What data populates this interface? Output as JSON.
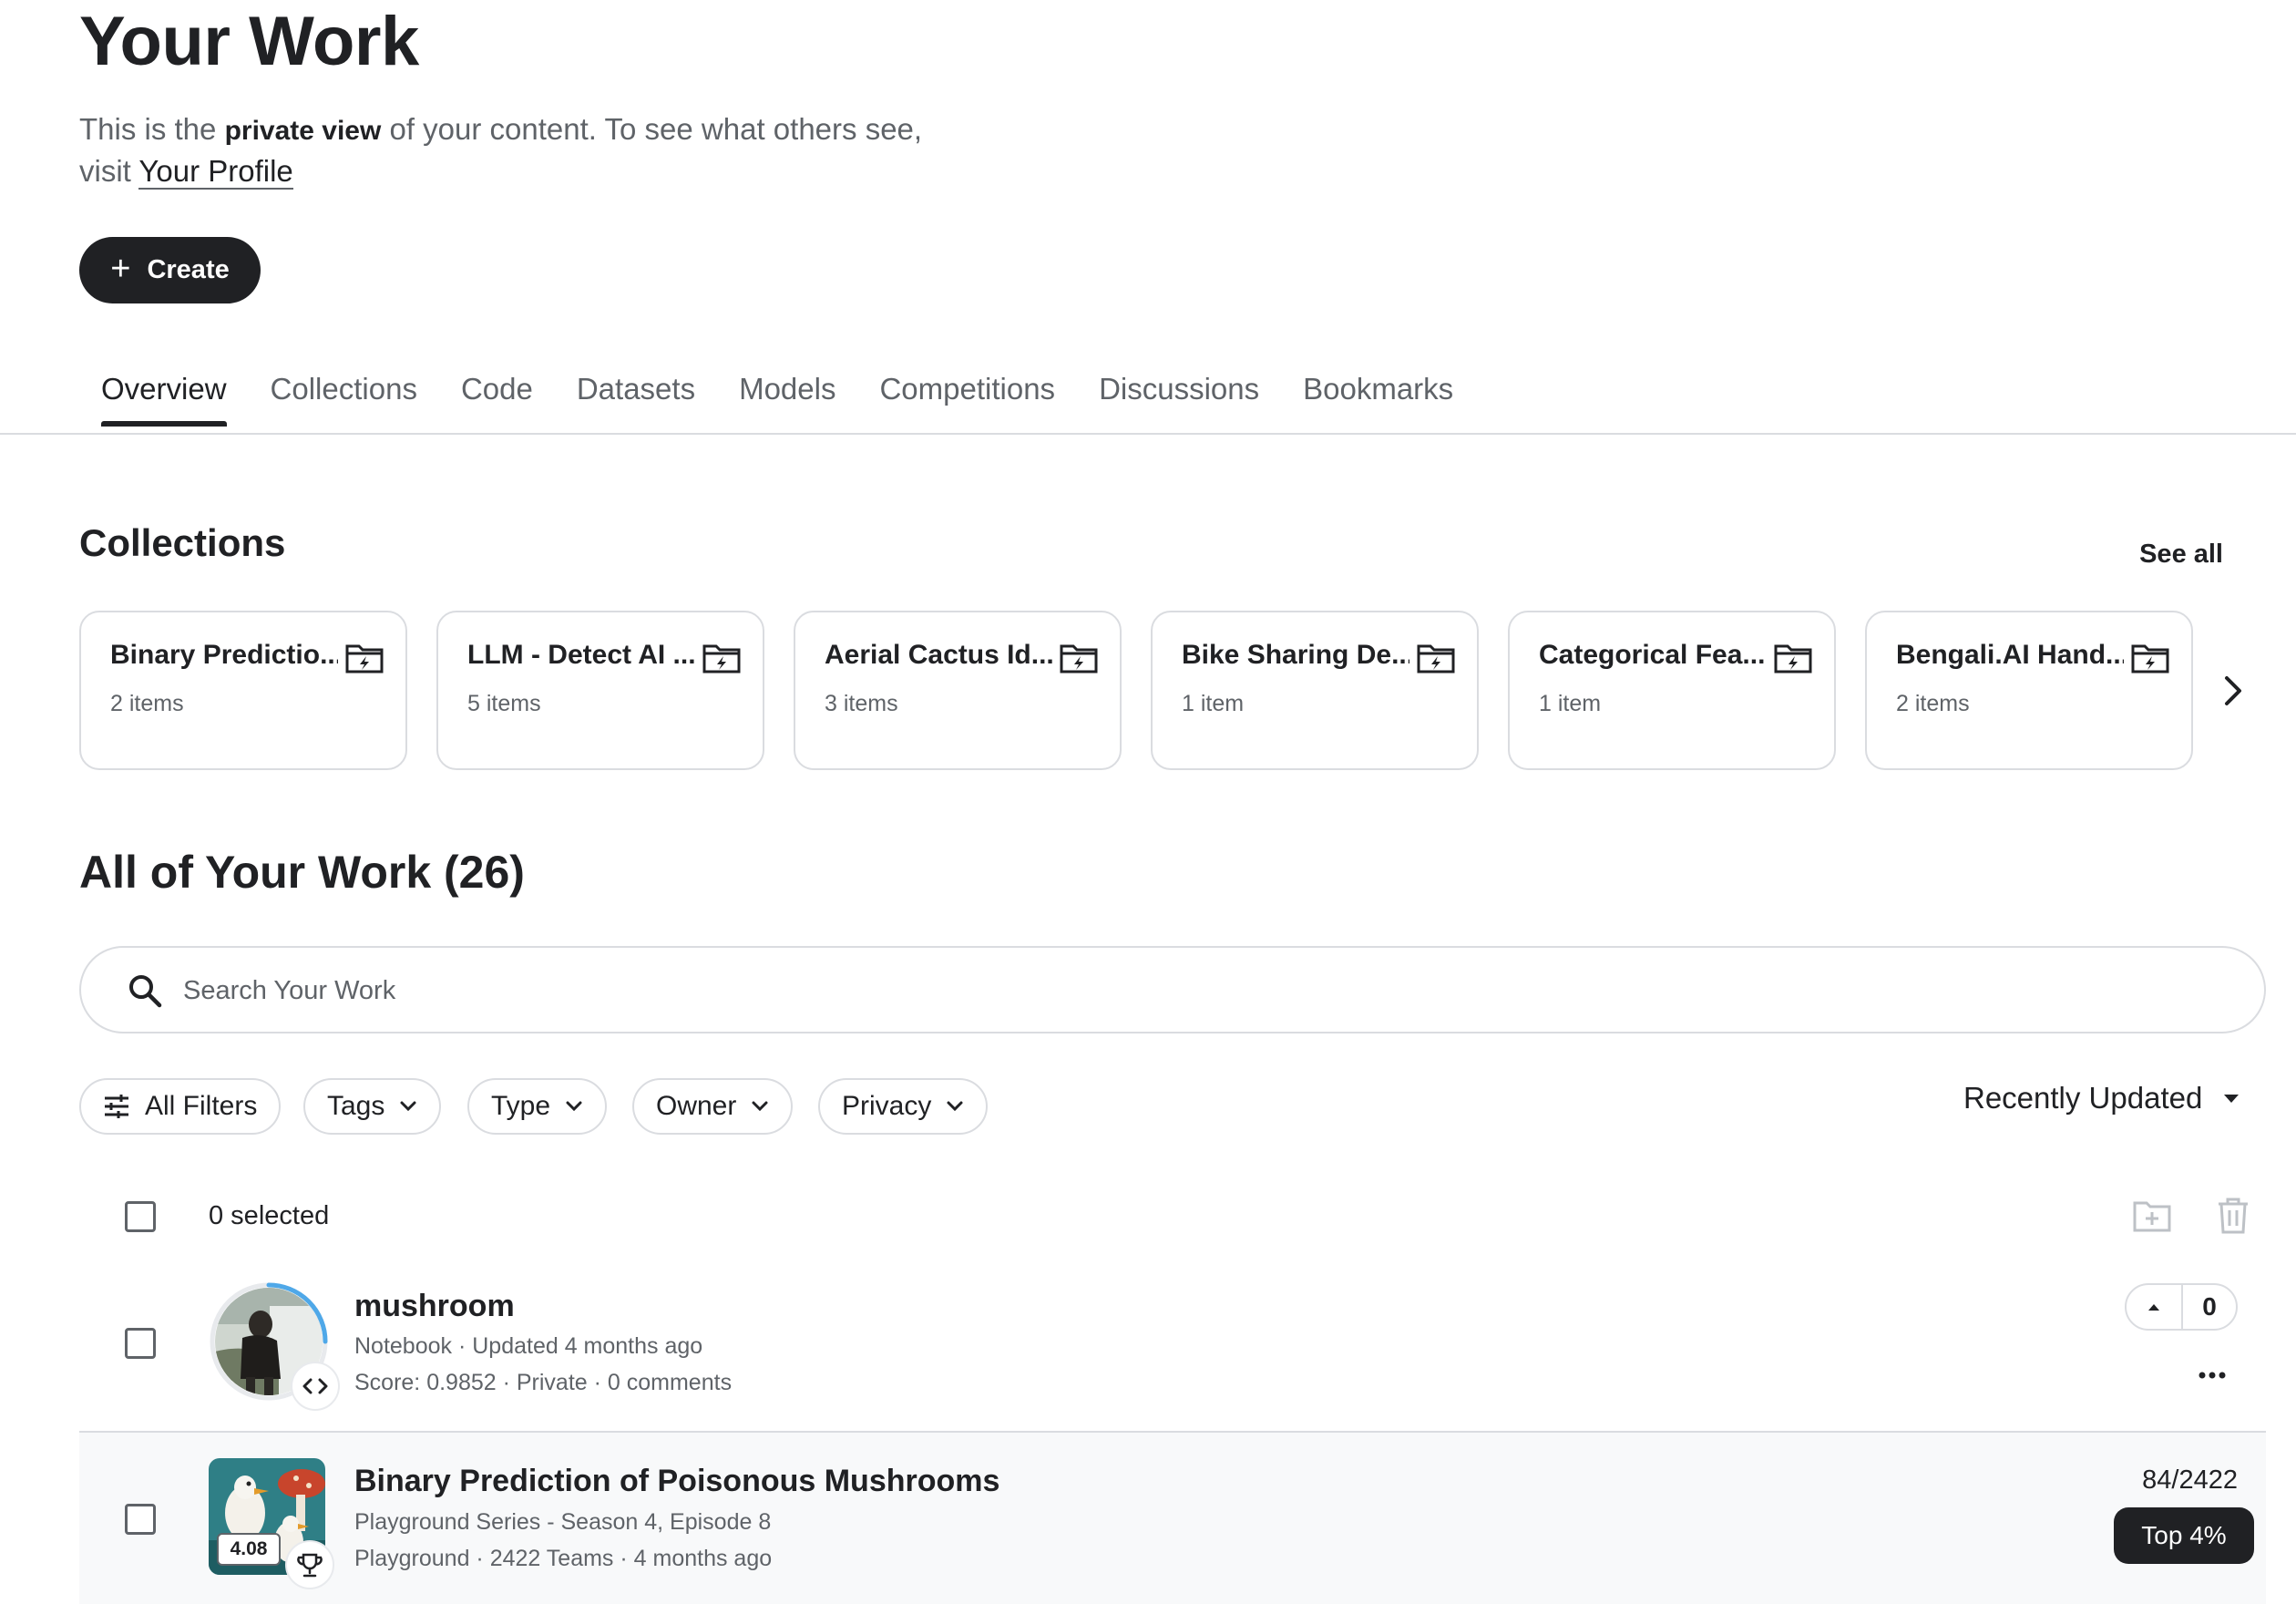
{
  "header": {
    "title": "Your Work",
    "subtitle_before": "This is the ",
    "subtitle_bold": "private view",
    "subtitle_after": " of your content. To see what others see,",
    "subtitle_line2": "visit ",
    "profile_link": "Your Profile",
    "create_label": "Create"
  },
  "tabs": [
    "Overview",
    "Collections",
    "Code",
    "Datasets",
    "Models",
    "Competitions",
    "Discussions",
    "Bookmarks"
  ],
  "collections": {
    "title": "Collections",
    "see_all": "See all",
    "items": [
      {
        "name": "Binary Predictio...",
        "count": "2 items"
      },
      {
        "name": "LLM - Detect AI ...",
        "count": "5 items"
      },
      {
        "name": "Aerial Cactus Id...",
        "count": "3 items"
      },
      {
        "name": "Bike Sharing De...",
        "count": "1 item"
      },
      {
        "name": "Categorical Fea...",
        "count": "1 item"
      },
      {
        "name": "Bengali.AI Hand...",
        "count": "2 items"
      }
    ]
  },
  "all_work": {
    "title": "All of Your Work (26)",
    "search_placeholder": "Search Your Work",
    "filters": {
      "all": "All Filters",
      "tags": "Tags",
      "type": "Type",
      "owner": "Owner",
      "privacy": "Privacy"
    },
    "sort": "Recently Updated",
    "selected": "0 selected",
    "items": [
      {
        "title": "mushroom",
        "meta1": "Notebook · Updated 4 months ago",
        "meta2": "Score: 0.9852 · Private · 0 comments",
        "votes": "0"
      },
      {
        "title": "Binary Prediction of Poisonous Mushrooms",
        "meta1": "Playground Series - Season 4, Episode 8",
        "meta2": "Playground · 2422 Teams · 4 months ago",
        "score_badge": "4.08",
        "rank": "84/2422",
        "top": "Top 4%"
      }
    ]
  },
  "colors": {
    "primary": "#202124",
    "secondary_text": "#5f6368",
    "border": "#dadce0",
    "progress_ring": "#4fa8e8"
  }
}
